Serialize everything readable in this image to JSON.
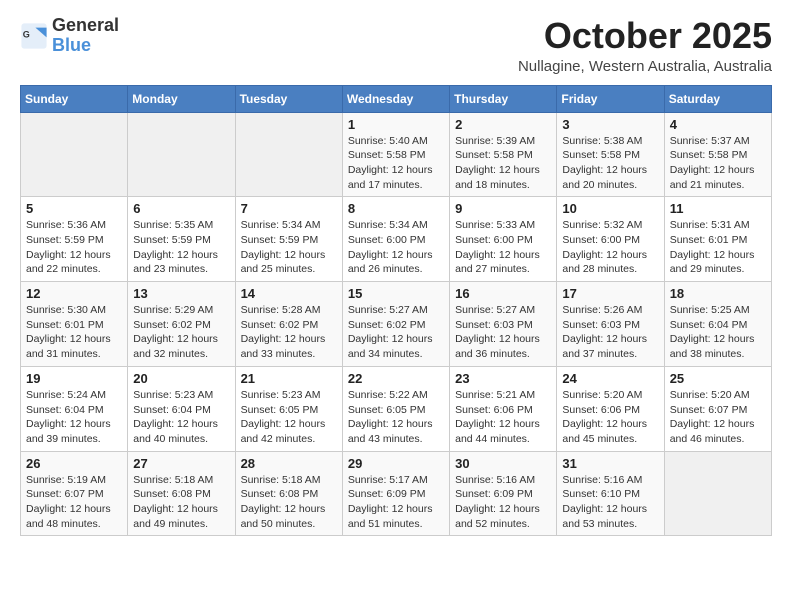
{
  "header": {
    "logo_general": "General",
    "logo_blue": "Blue",
    "title": "October 2025",
    "subtitle": "Nullagine, Western Australia, Australia"
  },
  "weekdays": [
    "Sunday",
    "Monday",
    "Tuesday",
    "Wednesday",
    "Thursday",
    "Friday",
    "Saturday"
  ],
  "weeks": [
    [
      {
        "day": "",
        "info": ""
      },
      {
        "day": "",
        "info": ""
      },
      {
        "day": "",
        "info": ""
      },
      {
        "day": "1",
        "info": "Sunrise: 5:40 AM\nSunset: 5:58 PM\nDaylight: 12 hours and 17 minutes."
      },
      {
        "day": "2",
        "info": "Sunrise: 5:39 AM\nSunset: 5:58 PM\nDaylight: 12 hours and 18 minutes."
      },
      {
        "day": "3",
        "info": "Sunrise: 5:38 AM\nSunset: 5:58 PM\nDaylight: 12 hours and 20 minutes."
      },
      {
        "day": "4",
        "info": "Sunrise: 5:37 AM\nSunset: 5:58 PM\nDaylight: 12 hours and 21 minutes."
      }
    ],
    [
      {
        "day": "5",
        "info": "Sunrise: 5:36 AM\nSunset: 5:59 PM\nDaylight: 12 hours and 22 minutes."
      },
      {
        "day": "6",
        "info": "Sunrise: 5:35 AM\nSunset: 5:59 PM\nDaylight: 12 hours and 23 minutes."
      },
      {
        "day": "7",
        "info": "Sunrise: 5:34 AM\nSunset: 5:59 PM\nDaylight: 12 hours and 25 minutes."
      },
      {
        "day": "8",
        "info": "Sunrise: 5:34 AM\nSunset: 6:00 PM\nDaylight: 12 hours and 26 minutes."
      },
      {
        "day": "9",
        "info": "Sunrise: 5:33 AM\nSunset: 6:00 PM\nDaylight: 12 hours and 27 minutes."
      },
      {
        "day": "10",
        "info": "Sunrise: 5:32 AM\nSunset: 6:00 PM\nDaylight: 12 hours and 28 minutes."
      },
      {
        "day": "11",
        "info": "Sunrise: 5:31 AM\nSunset: 6:01 PM\nDaylight: 12 hours and 29 minutes."
      }
    ],
    [
      {
        "day": "12",
        "info": "Sunrise: 5:30 AM\nSunset: 6:01 PM\nDaylight: 12 hours and 31 minutes."
      },
      {
        "day": "13",
        "info": "Sunrise: 5:29 AM\nSunset: 6:02 PM\nDaylight: 12 hours and 32 minutes."
      },
      {
        "day": "14",
        "info": "Sunrise: 5:28 AM\nSunset: 6:02 PM\nDaylight: 12 hours and 33 minutes."
      },
      {
        "day": "15",
        "info": "Sunrise: 5:27 AM\nSunset: 6:02 PM\nDaylight: 12 hours and 34 minutes."
      },
      {
        "day": "16",
        "info": "Sunrise: 5:27 AM\nSunset: 6:03 PM\nDaylight: 12 hours and 36 minutes."
      },
      {
        "day": "17",
        "info": "Sunrise: 5:26 AM\nSunset: 6:03 PM\nDaylight: 12 hours and 37 minutes."
      },
      {
        "day": "18",
        "info": "Sunrise: 5:25 AM\nSunset: 6:04 PM\nDaylight: 12 hours and 38 minutes."
      }
    ],
    [
      {
        "day": "19",
        "info": "Sunrise: 5:24 AM\nSunset: 6:04 PM\nDaylight: 12 hours and 39 minutes."
      },
      {
        "day": "20",
        "info": "Sunrise: 5:23 AM\nSunset: 6:04 PM\nDaylight: 12 hours and 40 minutes."
      },
      {
        "day": "21",
        "info": "Sunrise: 5:23 AM\nSunset: 6:05 PM\nDaylight: 12 hours and 42 minutes."
      },
      {
        "day": "22",
        "info": "Sunrise: 5:22 AM\nSunset: 6:05 PM\nDaylight: 12 hours and 43 minutes."
      },
      {
        "day": "23",
        "info": "Sunrise: 5:21 AM\nSunset: 6:06 PM\nDaylight: 12 hours and 44 minutes."
      },
      {
        "day": "24",
        "info": "Sunrise: 5:20 AM\nSunset: 6:06 PM\nDaylight: 12 hours and 45 minutes."
      },
      {
        "day": "25",
        "info": "Sunrise: 5:20 AM\nSunset: 6:07 PM\nDaylight: 12 hours and 46 minutes."
      }
    ],
    [
      {
        "day": "26",
        "info": "Sunrise: 5:19 AM\nSunset: 6:07 PM\nDaylight: 12 hours and 48 minutes."
      },
      {
        "day": "27",
        "info": "Sunrise: 5:18 AM\nSunset: 6:08 PM\nDaylight: 12 hours and 49 minutes."
      },
      {
        "day": "28",
        "info": "Sunrise: 5:18 AM\nSunset: 6:08 PM\nDaylight: 12 hours and 50 minutes."
      },
      {
        "day": "29",
        "info": "Sunrise: 5:17 AM\nSunset: 6:09 PM\nDaylight: 12 hours and 51 minutes."
      },
      {
        "day": "30",
        "info": "Sunrise: 5:16 AM\nSunset: 6:09 PM\nDaylight: 12 hours and 52 minutes."
      },
      {
        "day": "31",
        "info": "Sunrise: 5:16 AM\nSunset: 6:10 PM\nDaylight: 12 hours and 53 minutes."
      },
      {
        "day": "",
        "info": ""
      }
    ]
  ]
}
